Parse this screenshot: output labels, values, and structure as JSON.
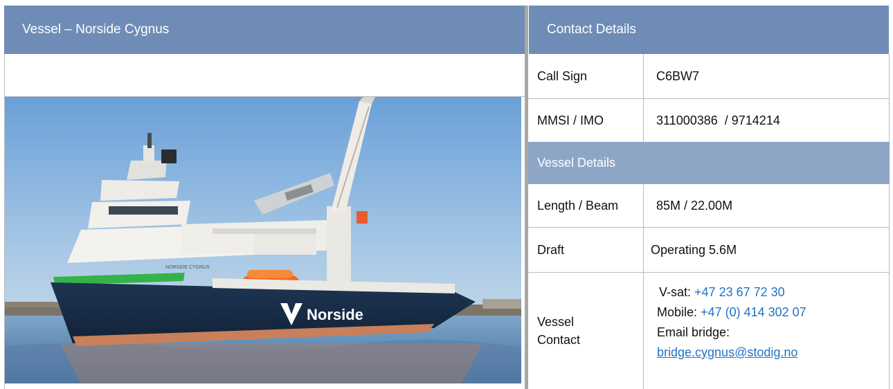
{
  "vessel": {
    "header": "Vessel – Norside Cygnus",
    "photo_brand_text": "Norside",
    "photo_hull_name": "NORSIDE CYGNUS"
  },
  "contact": {
    "header": "Contact Details",
    "rows": [
      {
        "label": "Call Sign",
        "value": "C6BW7"
      },
      {
        "label": "MMSI / IMO",
        "value": "311000386  / 9714214"
      }
    ]
  },
  "details": {
    "header": "Vessel Details",
    "rows": [
      {
        "label": "Length / Beam",
        "value": "85M / 22.00M"
      },
      {
        "label": "Draft",
        "value": "Operating 5.6M"
      }
    ],
    "contact_row": {
      "label_line1": "Vessel",
      "label_line2": "Contact",
      "vsat_label": "V-sat:",
      "vsat_value": "+47 23 67 72 30",
      "mobile_label": "Mobile:",
      "mobile_value": "+47 (0) 414 302 07",
      "email_label": "Email bridge:",
      "email_value": "bridge.cygnus@stodig.no"
    }
  },
  "colors": {
    "header_bg": "#6e8cb6",
    "subheader_bg": "#8ea6c6",
    "link": "#1f73c5"
  }
}
